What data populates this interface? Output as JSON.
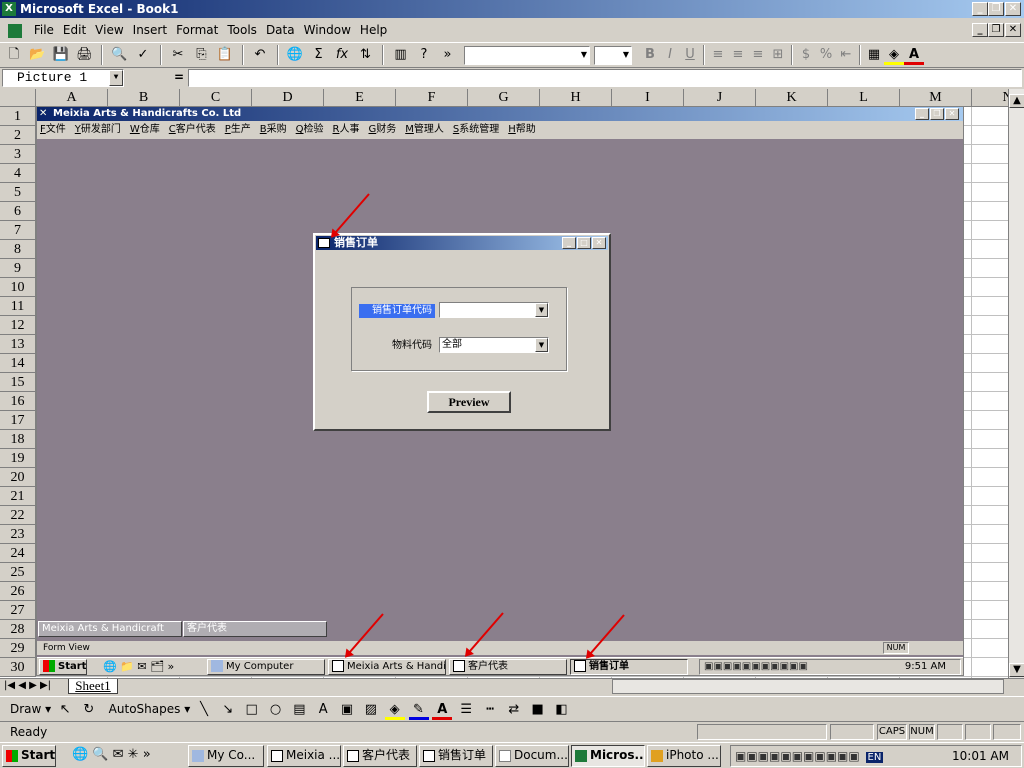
{
  "excel": {
    "title": "Microsoft Excel - Book1",
    "menu": [
      "File",
      "Edit",
      "View",
      "Insert",
      "Format",
      "Tools",
      "Data",
      "Window",
      "Help"
    ],
    "menu_accel": [
      "F",
      "E",
      "V",
      "I",
      "O",
      "T",
      "D",
      "W",
      "H"
    ],
    "name_box": "Picture 1",
    "fx": "=",
    "columns": [
      "A",
      "B",
      "C",
      "D",
      "E",
      "F",
      "G",
      "H",
      "I",
      "J",
      "K",
      "L",
      "M",
      "N"
    ],
    "rows": [
      "1",
      "2",
      "3",
      "4",
      "5",
      "6",
      "7",
      "8",
      "9",
      "10",
      "11",
      "12",
      "13",
      "14",
      "15",
      "16",
      "17",
      "18",
      "19",
      "20",
      "21",
      "22",
      "23",
      "24",
      "25",
      "26",
      "27",
      "28",
      "29",
      "30"
    ],
    "sheet_tab": "Sheet1",
    "draw_label": "Draw",
    "autoshapes_label": "AutoShapes",
    "status": "Ready",
    "caps": "CAPS",
    "num": "NUM"
  },
  "app": {
    "title": "Meixia Arts & Handicrafts Co. Ltd",
    "menu": [
      {
        "k": "F",
        "l": "文件"
      },
      {
        "k": "Y",
        "l": "研发部门"
      },
      {
        "k": "W",
        "l": "仓库"
      },
      {
        "k": "C",
        "l": "客户代表"
      },
      {
        "k": "P",
        "l": "生产"
      },
      {
        "k": "B",
        "l": "采购"
      },
      {
        "k": "Q",
        "l": "检验"
      },
      {
        "k": "R",
        "l": "人事"
      },
      {
        "k": "G",
        "l": "财务"
      },
      {
        "k": "M",
        "l": "管理人"
      },
      {
        "k": "S",
        "l": "系统管理"
      },
      {
        "k": "H",
        "l": "帮助"
      }
    ],
    "minimized": [
      "Meixia Arts & Handicraft",
      "客户代表"
    ],
    "status": "Form View",
    "status_num": "NUM"
  },
  "dialog": {
    "title": "销售订单",
    "field1_label": "销售订单代码",
    "field1_value": "",
    "field2_label": "物料代码",
    "field2_value": "全部",
    "preview": "Preview"
  },
  "inner_taskbar": {
    "start": "Start",
    "tasks": [
      "My Computer",
      "Meixia Arts & Handi...",
      "客户代表",
      "销售订单"
    ],
    "clock": "9:51 AM"
  },
  "taskbar": {
    "start": "Start",
    "tasks": [
      "My Co...",
      "Meixia ...",
      "客户代表",
      "销售订单",
      "Docum...",
      "Micros...",
      "iPhoto ..."
    ],
    "clock": "10:01 AM",
    "lang": "EN"
  },
  "colors": {
    "title_blue": "#0a246a",
    "mdi_bg": "#8a7f8c",
    "highlight": "#3a6ef0",
    "arrow": "#e00000"
  }
}
